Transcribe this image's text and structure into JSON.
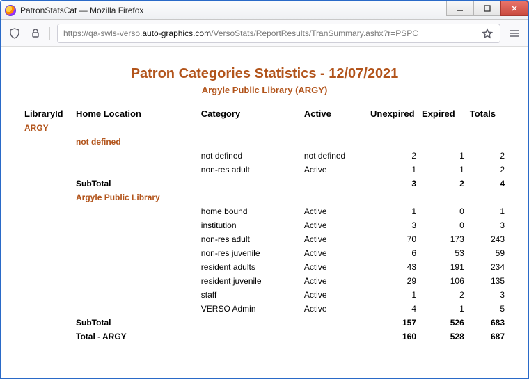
{
  "window": {
    "title": "PatronStatsCat — Mozilla Firefox"
  },
  "toolbar": {
    "url_pre": "https://qa-swls-verso.",
    "url_domain": "auto-graphics.com",
    "url_post": "/VersoStats/ReportResults/TranSummary.ashx?r=PSPC"
  },
  "report": {
    "title": "Patron Categories Statistics  -  12/07/2021",
    "subtitle": "Argyle Public Library (ARGY)",
    "headers": {
      "libraryId": "LibraryId",
      "homeLocation": "Home Location",
      "category": "Category",
      "active": "Active",
      "unexpired": "Unexpired",
      "expired": "Expired",
      "totals": "Totals"
    },
    "library_id": "ARGY",
    "sections": [
      {
        "location": "not defined",
        "rows": [
          {
            "category": "not defined",
            "active": "not defined",
            "unexpired": "2",
            "expired": "1",
            "totals": "2"
          },
          {
            "category": "non-res adult",
            "active": "Active",
            "unexpired": "1",
            "expired": "1",
            "totals": "2"
          }
        ],
        "subtotal_label": "SubTotal",
        "subtotal": {
          "unexpired": "3",
          "expired": "2",
          "totals": "4"
        }
      },
      {
        "location": "Argyle Public Library",
        "rows": [
          {
            "category": "home bound",
            "active": "Active",
            "unexpired": "1",
            "expired": "0",
            "totals": "1"
          },
          {
            "category": "institution",
            "active": "Active",
            "unexpired": "3",
            "expired": "0",
            "totals": "3"
          },
          {
            "category": "non-res adult",
            "active": "Active",
            "unexpired": "70",
            "expired": "173",
            "totals": "243"
          },
          {
            "category": "non-res juvenile",
            "active": "Active",
            "unexpired": "6",
            "expired": "53",
            "totals": "59"
          },
          {
            "category": "resident adults",
            "active": "Active",
            "unexpired": "43",
            "expired": "191",
            "totals": "234"
          },
          {
            "category": "resident juvenile",
            "active": "Active",
            "unexpired": "29",
            "expired": "106",
            "totals": "135"
          },
          {
            "category": "staff",
            "active": "Active",
            "unexpired": "1",
            "expired": "2",
            "totals": "3"
          },
          {
            "category": "VERSO Admin",
            "active": "Active",
            "unexpired": "4",
            "expired": "1",
            "totals": "5"
          }
        ],
        "subtotal_label": "SubTotal",
        "subtotal": {
          "unexpired": "157",
          "expired": "526",
          "totals": "683"
        }
      }
    ],
    "grand_total": {
      "label": "Total - ARGY",
      "unexpired": "160",
      "expired": "528",
      "totals": "687"
    }
  }
}
